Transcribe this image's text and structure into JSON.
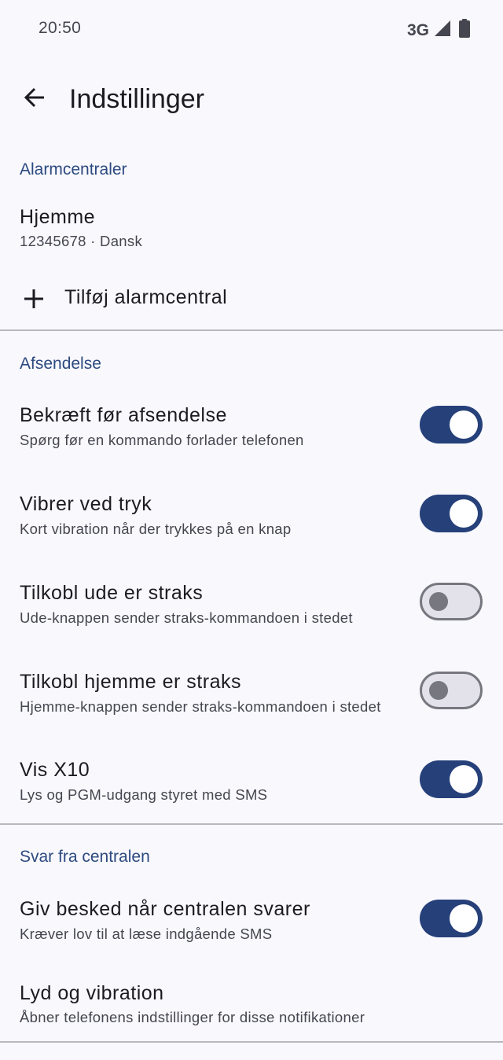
{
  "status_bar": {
    "time": "20:50",
    "network": "3G",
    "signal_icon": "signal-icon",
    "battery_icon": "battery-icon"
  },
  "app_bar": {
    "back_icon": "arrow-back-icon",
    "title": "Indstillinger"
  },
  "alarm_section": {
    "header": "Alarmcentraler",
    "items": [
      {
        "title": "Hjemme",
        "subtitle": "12345678 · Dansk"
      }
    ],
    "add_label": "Tilføj alarmcentral"
  },
  "sending_section": {
    "header": "Afsendelse",
    "items": [
      {
        "title": "Bekræft før afsendelse",
        "subtitle": "Spørg før en kommando forlader telefonen",
        "enabled": true
      },
      {
        "title": "Vibrer ved tryk",
        "subtitle": "Kort vibration når der trykkes på en knap",
        "enabled": true
      },
      {
        "title": "Tilkobl ude er straks",
        "subtitle": "Ude-knappen sender straks-kommandoen i stedet",
        "enabled": false
      },
      {
        "title": "Tilkobl hjemme er straks",
        "subtitle": "Hjemme-knappen sender straks-kommandoen i stedet",
        "enabled": false
      },
      {
        "title": "Vis X10",
        "subtitle": "Lys og PGM-udgang styret med SMS",
        "enabled": true
      }
    ]
  },
  "reply_section": {
    "header": "Svar fra centralen",
    "items": [
      {
        "title": "Giv besked når centralen svarer",
        "subtitle": "Kræver lov til at læse indgående SMS",
        "enabled": true
      },
      {
        "title": "Lyd og vibration",
        "subtitle": "Åbner telefonens indstillinger for disse notifikationer"
      }
    ]
  },
  "colors": {
    "background": "#f8f8fd",
    "accent": "#26407a",
    "section_header": "#2d4a80",
    "switch_off_track": "#e3e2ea",
    "switch_off_outline": "#76777f"
  }
}
